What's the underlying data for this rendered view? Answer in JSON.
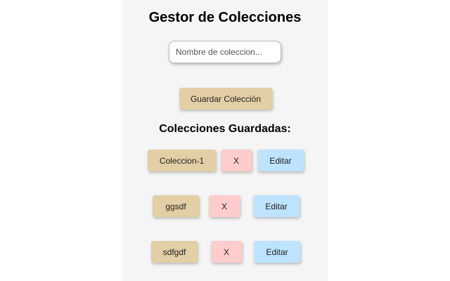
{
  "header": {
    "title": "Gestor de Colecciones"
  },
  "form": {
    "name_placeholder": "Nombre de coleccion...",
    "name_value": "",
    "save_label": "Guardar Colección"
  },
  "saved": {
    "heading": "Colecciones Guardadas:",
    "delete_label": "X",
    "edit_label": "Editar",
    "items": [
      {
        "name": "Coleccion-1"
      },
      {
        "name": "ggsdf"
      },
      {
        "name": "sdfgdf"
      }
    ]
  },
  "colors": {
    "panel_background": "#f5f5f5",
    "collection_button": "#e3cfa5",
    "delete_button": "#ffcccc",
    "edit_button": "#bde3ff"
  }
}
